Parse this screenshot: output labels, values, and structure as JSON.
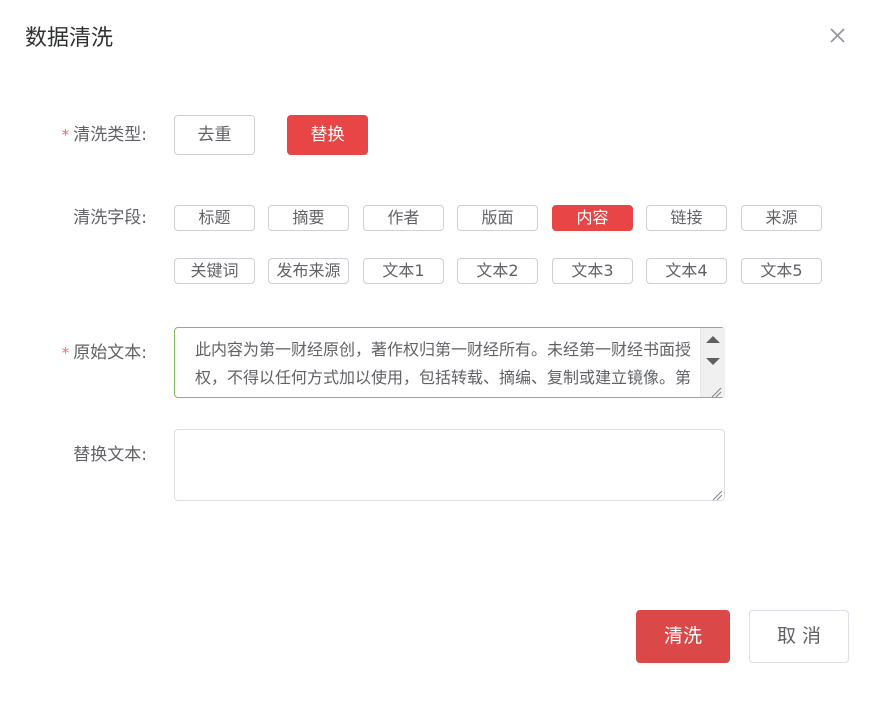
{
  "dialog": {
    "title": "数据清洗"
  },
  "form": {
    "clean_type": {
      "label": "清洗类型:",
      "required_mark": "*",
      "options": [
        "去重",
        "替换"
      ],
      "selected": "替换"
    },
    "clean_fields": {
      "label": "清洗字段:",
      "options_row1": [
        "标题",
        "摘要",
        "作者",
        "版面",
        "内容",
        "链接",
        "来源"
      ],
      "options_row2": [
        "关键词",
        "发布来源",
        "文本1",
        "文本2",
        "文本3",
        "文本4",
        "文本5"
      ],
      "selected": "内容"
    },
    "original_text": {
      "label": "原始文本:",
      "required_mark": "*",
      "value": "此内容为第一财经原创，著作权归第一财经所有。未经第一财经书面授权，不得以任何方式加以使用，包括转载、摘编、复制或建立镜像。第一财经保留追究侵权者法律责任的权利。"
    },
    "replace_text": {
      "label": "替换文本:",
      "value": ""
    }
  },
  "footer": {
    "confirm_label": "清洗",
    "cancel_label": "取 消"
  },
  "colors": {
    "accent": "#e84646",
    "required": "#f56c6c",
    "focus_border": "#7fbf5a"
  }
}
